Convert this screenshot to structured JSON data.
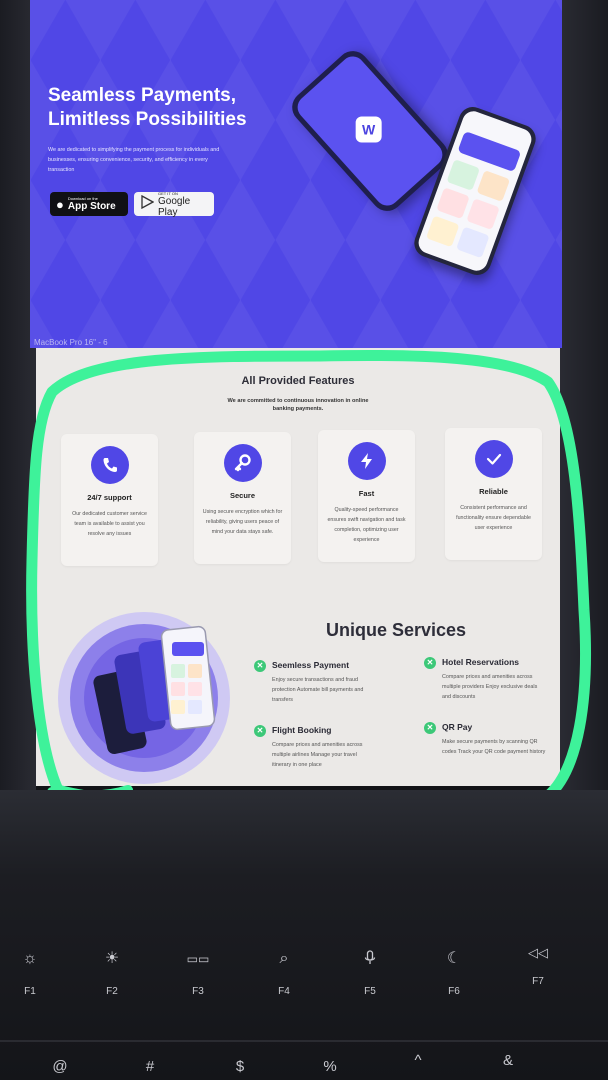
{
  "hero": {
    "title_line1": "Seamless Payments,",
    "title_line2": "Limitless Possibilities",
    "description": "We are dedicated to simplifying the payment process for individuals and businesses, ensuring convenience, security, and efficiency in every transaction",
    "appstore": {
      "small": "Download on the",
      "big": "App Store"
    },
    "googleplay": {
      "small": "GET IT ON",
      "big": "Google Play"
    },
    "frame_caption": "MacBook Pro 16\" - 6"
  },
  "features": {
    "title": "All Provided Features",
    "subtitle": "We are committed to continuous innovation in online banking payments.",
    "items": [
      {
        "title": "24/7 support",
        "text": "Our dedicated customer service team is available to assist you resolve any issues",
        "icon": "phone-icon"
      },
      {
        "title": "Secure",
        "text": "Using secure encryption which for reliability, giving users peace of mind your data stays safe.",
        "icon": "key-icon"
      },
      {
        "title": "Fast",
        "text": "Quality-speed performance ensures swift navigation and task completion, optimizing user experience",
        "icon": "lightning-icon"
      },
      {
        "title": "Reliable",
        "text": "Consistent performance and functionality ensure dependable user experience",
        "icon": "checkmark-icon"
      }
    ]
  },
  "services": {
    "title": "Unique Services",
    "items": [
      {
        "name": "Seemless Payment",
        "desc": "Enjoy secure transactions and fraud protection Automate bill payments and transfers"
      },
      {
        "name": "Hotel Reservations",
        "desc": "Compare prices and amenities across multiple providers Enjoy exclusive deals and discounts"
      },
      {
        "name": "Flight Booking",
        "desc": "Compare prices and amenities across multiple airlines Manage your travel itinerary in one place"
      },
      {
        "name": "QR Pay",
        "desc": "Make secure payments by scanning QR codes Track your QR code payment history"
      }
    ]
  },
  "keyboard": {
    "fkeys": [
      {
        "label": "F1",
        "icon": "brightness-down-icon",
        "glyph": "☼"
      },
      {
        "label": "F2",
        "icon": "brightness-up-icon",
        "glyph": "☀"
      },
      {
        "label": "F3",
        "icon": "mission-control-icon",
        "glyph": "▭▭"
      },
      {
        "label": "F4",
        "icon": "search-icon",
        "glyph": "⌕"
      },
      {
        "label": "F5",
        "icon": "microphone-icon",
        "glyph": "🎙"
      },
      {
        "label": "F6",
        "icon": "moon-icon",
        "glyph": "☾"
      },
      {
        "label": "F7",
        "icon": "rewind-icon",
        "glyph": "⏪"
      }
    ],
    "number_row": [
      "@",
      "#",
      "$",
      "%",
      "^",
      "&"
    ]
  },
  "colors": {
    "brand": "#5047e6",
    "highlight": "#3ef29a",
    "check": "#3cc878"
  }
}
